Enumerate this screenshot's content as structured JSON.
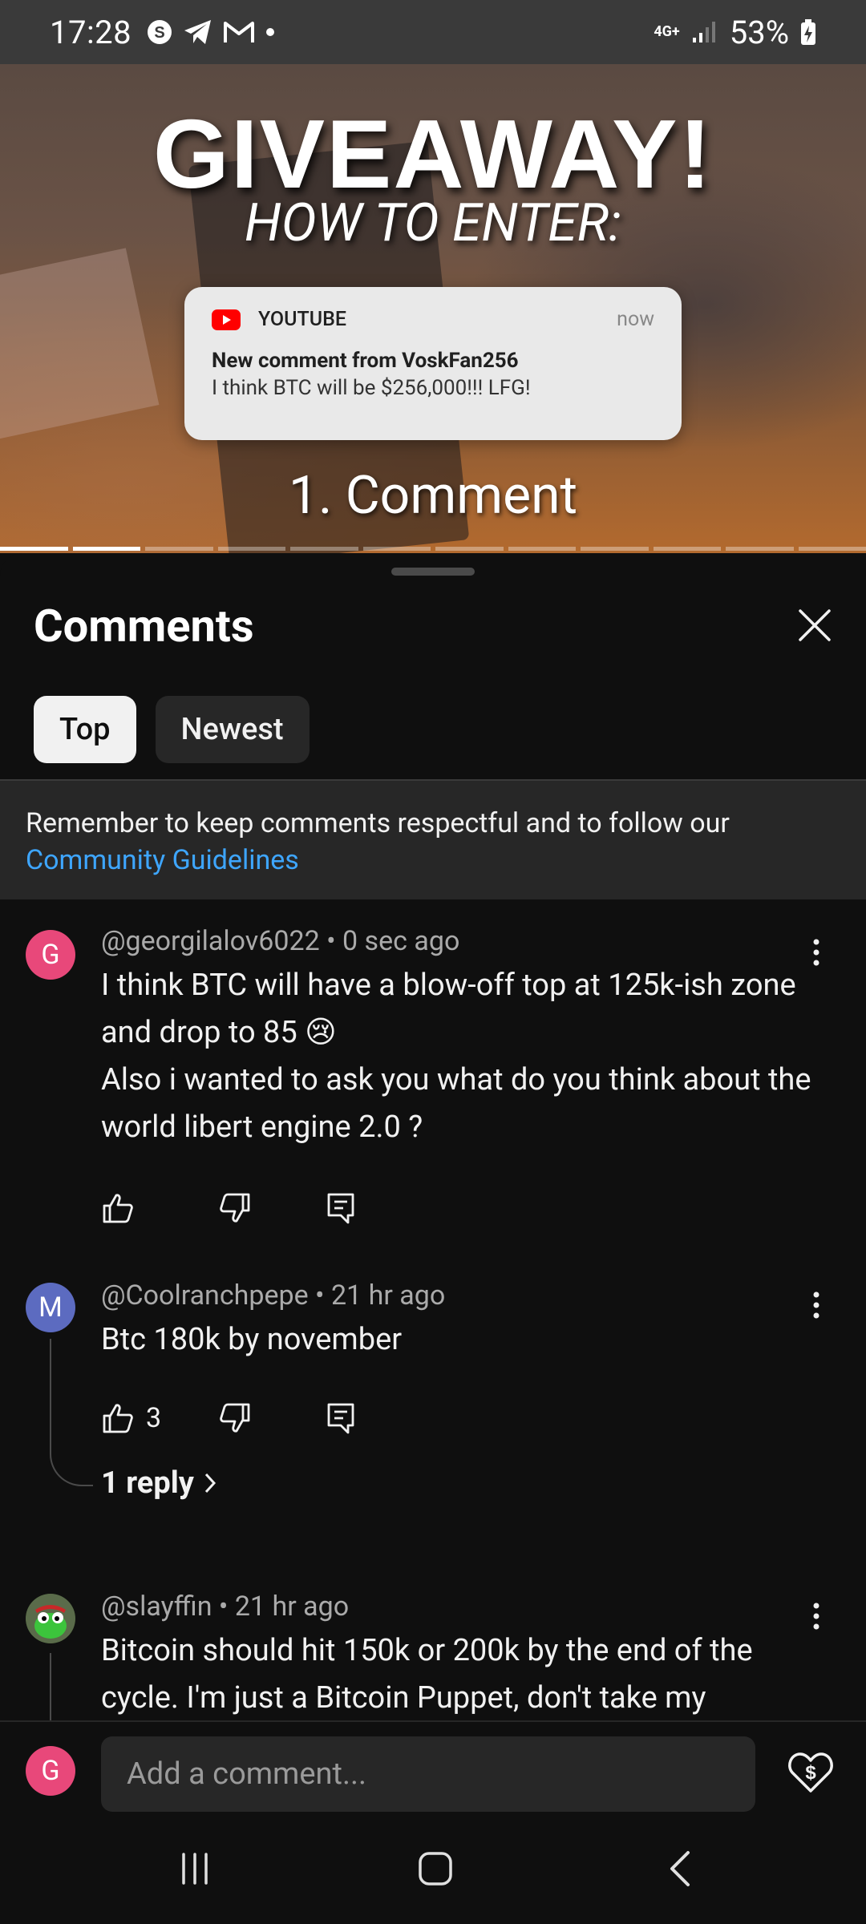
{
  "status_bar": {
    "time": "17:28",
    "network": "4G+",
    "battery": "53%"
  },
  "video": {
    "headline": "GIVEAWAY!",
    "subheadline": "HOW TO ENTER:",
    "notification": {
      "app": "YOUTUBE",
      "time": "now",
      "title": "New comment from VoskFan256",
      "body": "I think BTC will be $256,000!!! LFG!"
    },
    "step_text": "1. Comment",
    "progress": {
      "segments": 12,
      "completed": 2
    }
  },
  "comments_panel": {
    "title": "Comments",
    "tabs": [
      {
        "label": "Top",
        "active": true
      },
      {
        "label": "Newest",
        "active": false
      }
    ],
    "notice": {
      "text": "Remember to keep comments respectful and to follow our",
      "link": "Community Guidelines"
    },
    "comments": [
      {
        "avatar_letter": "G",
        "avatar_color": "#e8487a",
        "author": "@georgilalov6022",
        "time": "0 sec ago",
        "meta": "@georgilalov6022 • 0 sec ago",
        "text": "I think BTC will have a blow-off top at 125k-ish zone and drop to 85 😢\nAlso i wanted to ask you what do you think about the world libert engine 2.0 ?",
        "likes": ""
      },
      {
        "avatar_letter": "M",
        "avatar_color": "#5c6bc0",
        "author": "@Coolranchpepe",
        "time": "21 hr ago",
        "meta": "@Coolranchpepe • 21 hr ago",
        "text": "Btc 180k by november",
        "likes": "3",
        "replies_label": "1 reply"
      },
      {
        "avatar_letter": "",
        "avatar_color": "#3a5a2a",
        "author": "@slayffin",
        "time": "21 hr ago",
        "meta": "@slayffin • 21 hr ago",
        "text": "Bitcoin should hit 150k or 200k by the end of the cycle. I'm just a Bitcoin Puppet, don't take my"
      }
    ],
    "composer": {
      "avatar_letter": "G",
      "placeholder": "Add a comment..."
    }
  }
}
